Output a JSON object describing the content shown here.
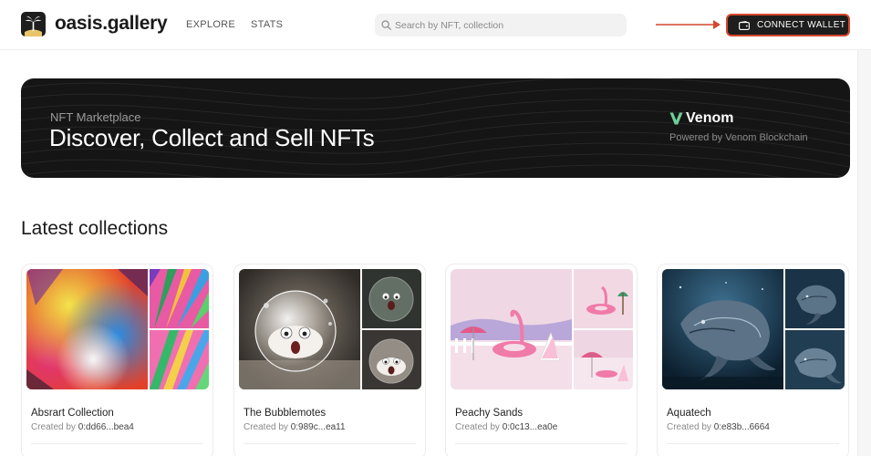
{
  "header": {
    "brand": "oasis.gallery",
    "nav": [
      "EXPLORE",
      "STATS"
    ],
    "search_placeholder": "Search by NFT, collection",
    "connect_wallet": "CONNECT WALLET",
    "annotation_arrow_color": "#d6472c"
  },
  "banner": {
    "subtitle": "NFT Marketplace",
    "title": "Discover, Collect and Sell NFTs",
    "partner_name": "Venom",
    "partner_tagline": "Powered by Venom Blockchain",
    "accent": "#6fcf97"
  },
  "section": {
    "title": "Latest collections"
  },
  "collections": [
    {
      "name": "Absrart Collection",
      "created_by_label": "Created by",
      "creator": "0:dd66...bea4",
      "art": "abstract-color-splash"
    },
    {
      "name": "The Bubblemotes",
      "created_by_label": "Created by",
      "creator": "0:989c...ea11",
      "art": "bubble-creatures"
    },
    {
      "name": "Peachy Sands",
      "created_by_label": "Created by",
      "creator": "0:0c13...ea0e",
      "art": "pink-flamingo-beach"
    },
    {
      "name": "Aquatech",
      "created_by_label": "Created by",
      "creator": "0:e83b...6664",
      "art": "mechanical-whale"
    }
  ]
}
